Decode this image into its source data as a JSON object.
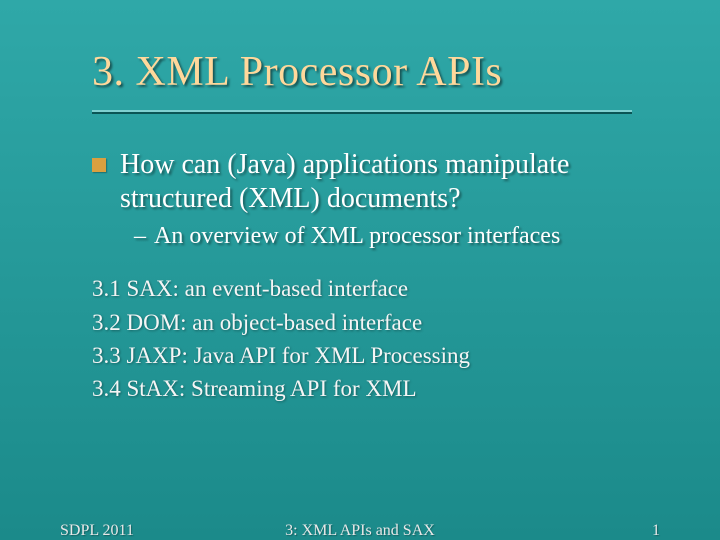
{
  "title": "3. XML Processor APIs",
  "main": "How can (Java) applications manipulate structured (XML) documents?",
  "sub": "An overview of XML processor interfaces",
  "items": [
    "3.1 SAX: an event-based interface",
    "3.2 DOM: an object-based interface",
    "3.3 JAXP: Java API for XML Processing",
    "3.4 StAX: Streaming API for XML"
  ],
  "footer": {
    "left": "SDPL 2011",
    "center": "3: XML APIs and SAX",
    "right": "1"
  }
}
